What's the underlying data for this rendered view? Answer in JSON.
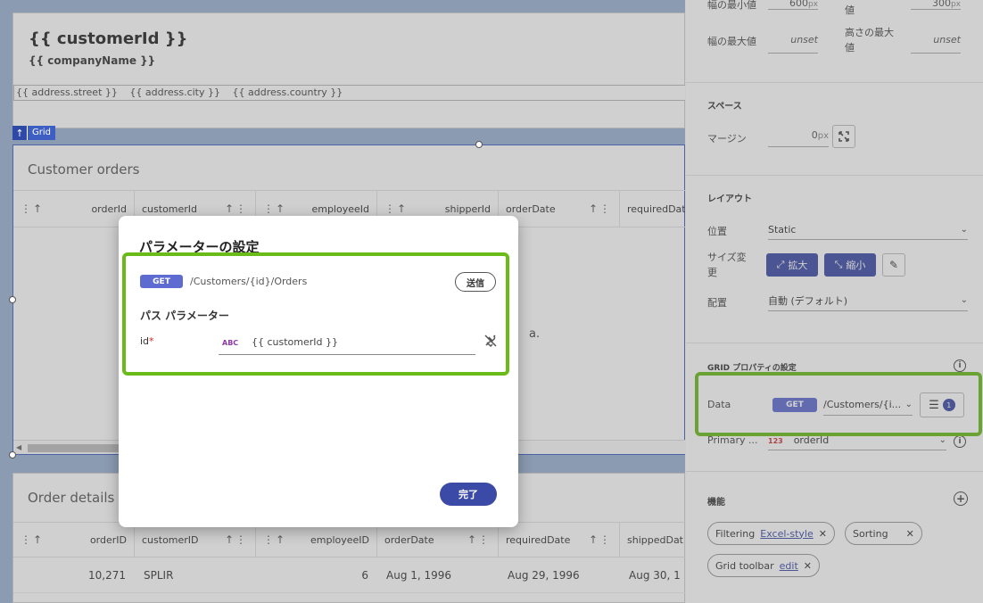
{
  "canvas": {
    "customer_id": "{{ customerId }}",
    "company_name": "{{ companyName }}",
    "address_parts": [
      "{{ address.street }}",
      "{{ address.city }}",
      "{{ address.country }}"
    ],
    "grid_tag": "Grid",
    "customer_orders": {
      "title": "Customer orders",
      "columns": [
        "orderId",
        "customerId",
        "employeeId",
        "shipperId",
        "orderDate",
        "requiredDat"
      ],
      "no_data_fragment": "a."
    },
    "order_details": {
      "title": "Order details",
      "columns": [
        "orderID",
        "customerID",
        "employeeID",
        "orderDate",
        "requiredDate",
        "shippedDat"
      ],
      "rows": [
        [
          "10,271",
          "SPLIR",
          "6",
          "Aug 1, 1996",
          "Aug 29, 1996",
          "Aug 30, 1"
        ]
      ]
    }
  },
  "modal": {
    "title": "パラメーターの設定",
    "method": "GET",
    "url": "/Customers/{id}/Orders",
    "send_label": "送信",
    "path_params_label": "パス パラメーター",
    "param_name": "id",
    "required_mark": "*",
    "param_type": "ABC",
    "param_value": "{{ customerId }}",
    "done_label": "完了"
  },
  "panel": {
    "size": {
      "min_width_label": "幅の最小値",
      "min_width_value": "600",
      "min_width_unit": "px",
      "min_height_label": "値",
      "min_height_value": "300",
      "min_height_unit": "px",
      "max_width_label": "幅の最大値",
      "max_width_value": "unset",
      "max_height_label": "高さの最大値",
      "max_height_value": "unset"
    },
    "space": {
      "heading": "スペース",
      "margin_label": "マージン",
      "margin_value": "0",
      "margin_unit": "px"
    },
    "layout": {
      "heading": "レイアウト",
      "position_label": "位置",
      "position_value": "Static",
      "resize_label": "サイズ変更",
      "expand_label": "拡大",
      "shrink_label": "縮小",
      "align_label": "配置",
      "align_value": "自動 (デフォルト)"
    },
    "grid_props": {
      "heading": "GRID プロパティの設定",
      "data_label": "Data",
      "data_method": "GET",
      "data_url": "/Customers/{i...",
      "param_count": "1",
      "primary_label": "Primary ...",
      "primary_type": "123",
      "primary_value": "orderId"
    },
    "features": {
      "heading": "機能",
      "filtering_label": "Filtering",
      "filtering_link": "Excel-style",
      "sorting_label": "Sorting",
      "toolbar_label": "Grid toolbar",
      "toolbar_link": "edit"
    }
  },
  "colors": {
    "highlight": "#6abb1a",
    "accent": "#3b4aa6",
    "get_badge": "#5e6bd0"
  }
}
